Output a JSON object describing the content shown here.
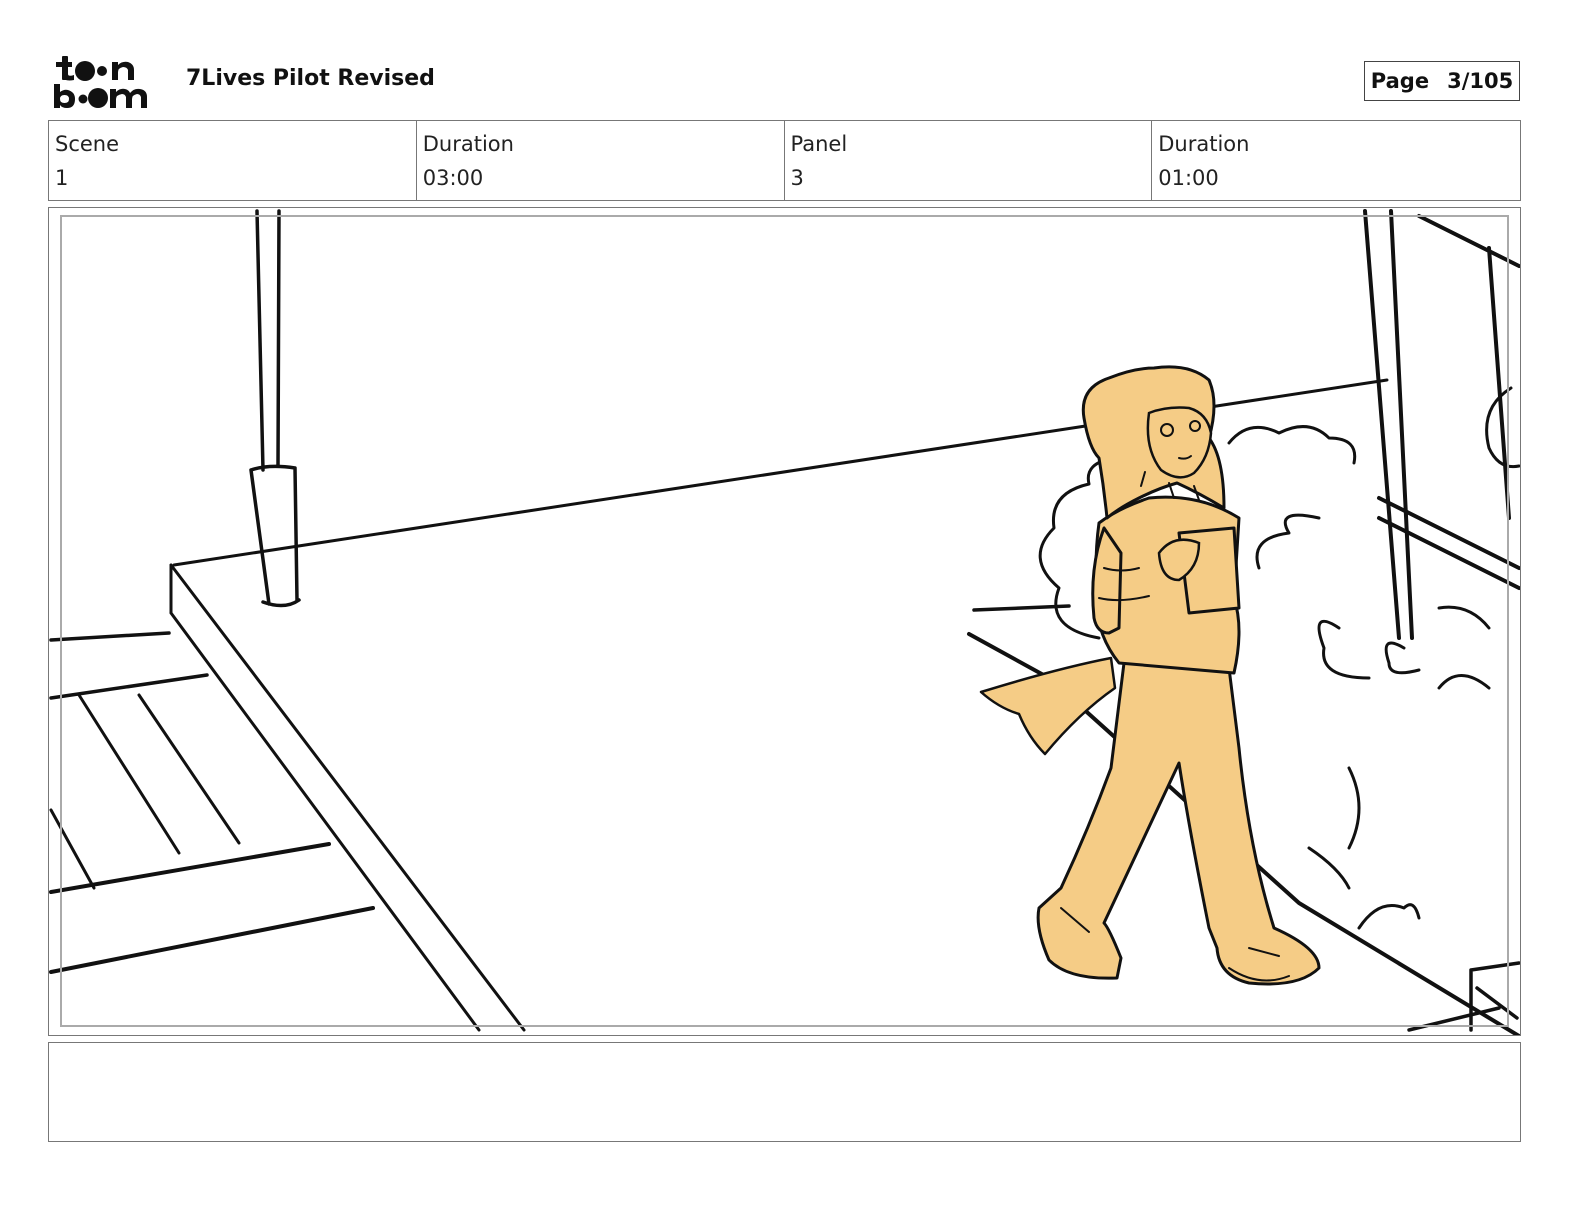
{
  "header": {
    "logo_name": "toon boom",
    "title": "7Lives Pilot Revised",
    "page_label": "Page",
    "page_value": "3/105"
  },
  "info": {
    "scene_label": "Scene",
    "scene_value": "1",
    "scene_duration_label": "Duration",
    "scene_duration_value": "03:00",
    "panel_label": "Panel",
    "panel_value": "3",
    "panel_duration_label": "Duration",
    "panel_duration_value": "01:00"
  },
  "panel": {
    "fill_color": "#f5cc86",
    "line_color": "#111111"
  },
  "notes": {
    "text": ""
  }
}
